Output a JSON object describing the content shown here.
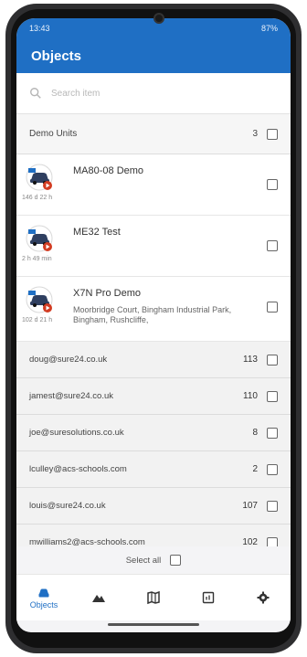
{
  "status": {
    "time": "13:43",
    "right": "87%"
  },
  "appbar": {
    "title": "Objects"
  },
  "search": {
    "placeholder": "Search item"
  },
  "group": {
    "name": "Demo Units",
    "count": "3"
  },
  "vehicles": [
    {
      "name": "MA80-08 Demo",
      "time": "146 d 22 h",
      "address": ""
    },
    {
      "name": "ME32 Test",
      "time": "2 h 49 min",
      "address": ""
    },
    {
      "name": "X7N Pro Demo",
      "time": "102 d 21 h",
      "address": "Moorbridge Court, Bingham Industrial Park, Bingham, Rushcliffe,"
    }
  ],
  "users": [
    {
      "email": "doug@sure24.co.uk",
      "count": "113"
    },
    {
      "email": "jamest@sure24.co.uk",
      "count": "110"
    },
    {
      "email": "joe@suresolutions.co.uk",
      "count": "8"
    },
    {
      "email": "lculley@acs-schools.com",
      "count": "2"
    },
    {
      "email": "louis@sure24.co.uk",
      "count": "107"
    },
    {
      "email": "mwilliams2@acs-schools.com",
      "count": "102"
    }
  ],
  "select_all": {
    "label": "Select all"
  },
  "nav": {
    "objects_label": "Objects"
  },
  "colors": {
    "primary": "#1f6fc4",
    "badge": "#d23b21"
  },
  "icons": {
    "car": "car-icon",
    "search": "search-icon",
    "tracks": "mountain-icon",
    "map": "map-icon",
    "reports": "report-icon",
    "settings": "gear-icon"
  }
}
